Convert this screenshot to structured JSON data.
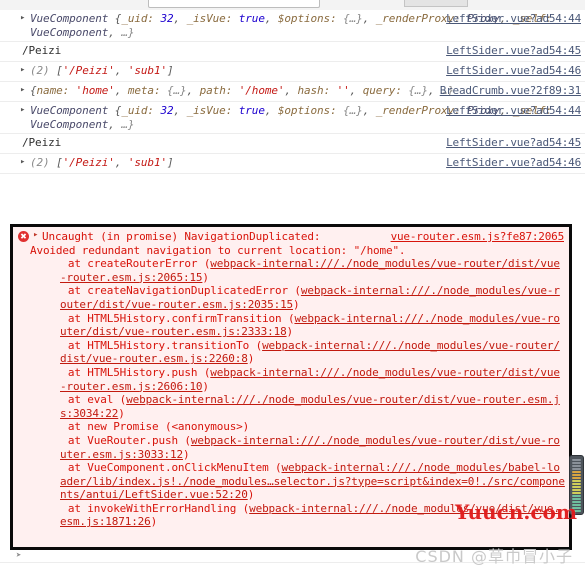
{
  "app": {
    "name": "chrome-devtools-console",
    "colors": {
      "error_text": "#d8140b",
      "error_bg": "#fff0f0",
      "source_link": "#4a5878",
      "string_token": "#c41a16",
      "number_token": "#1c00cf",
      "annotation_border": "#0a0a0a"
    }
  },
  "toolbar": {
    "filter_placeholder": ""
  },
  "console": {
    "messages": [
      {
        "type": "object",
        "disclosure": "▸",
        "text": "VueComponent {_uid: 32, _isVue: true, $options: {…}, _renderProxy: Proxy, _self: VueComponent, …}",
        "source": "LeftSider.vue?ad54:44",
        "parts": [
          {
            "t": "VueComponent ",
            "c": "tok-cls"
          },
          {
            "t": "{",
            "c": "tok-punc"
          },
          {
            "t": "_uid: ",
            "c": "tok-key"
          },
          {
            "t": "32",
            "c": "tok-num"
          },
          {
            "t": ", ",
            "c": "tok-punc"
          },
          {
            "t": "_isVue: ",
            "c": "tok-key"
          },
          {
            "t": "true",
            "c": "tok-bool"
          },
          {
            "t": ", ",
            "c": "tok-punc"
          },
          {
            "t": "$options: ",
            "c": "tok-key"
          },
          {
            "t": "{…}",
            "c": "tok-dim"
          },
          {
            "t": ", ",
            "c": "tok-punc"
          },
          {
            "t": "_renderProxy: ",
            "c": "tok-key"
          },
          {
            "t": "Proxy",
            "c": "tok-cls"
          },
          {
            "t": ", ",
            "c": "tok-punc"
          },
          {
            "t": "_self: ",
            "c": "tok-key"
          },
          {
            "t": "VueComponent",
            "c": "tok-cls"
          },
          {
            "t": ", ",
            "c": "tok-punc"
          },
          {
            "t": "…}",
            "c": "tok-dim"
          }
        ]
      },
      {
        "type": "string",
        "disclosure": "",
        "text": "/Peizi",
        "source": "LeftSider.vue?ad54:45",
        "parts": [
          {
            "t": "/Peizi",
            "c": "tok-name"
          }
        ]
      },
      {
        "type": "array",
        "disclosure": "▸",
        "text": "(2) ['/Peizi', 'sub1']",
        "source": "LeftSider.vue?ad54:46",
        "parts": [
          {
            "t": "(2) ",
            "c": "arr-count"
          },
          {
            "t": "[",
            "c": "tok-punc"
          },
          {
            "t": "'/Peizi'",
            "c": "tok-str"
          },
          {
            "t": ", ",
            "c": "tok-punc"
          },
          {
            "t": "'sub1'",
            "c": "tok-str"
          },
          {
            "t": "]",
            "c": "tok-punc"
          }
        ]
      },
      {
        "type": "object",
        "disclosure": "▸",
        "text": "{name: 'home', meta: {…}, path: '/home', hash: '', query: {…}, …}",
        "source": "BreadCrumb.vue?2f89:31",
        "parts": [
          {
            "t": "{",
            "c": "tok-punc"
          },
          {
            "t": "name: ",
            "c": "tok-key"
          },
          {
            "t": "'home'",
            "c": "tok-str"
          },
          {
            "t": ", ",
            "c": "tok-punc"
          },
          {
            "t": "meta: ",
            "c": "tok-key"
          },
          {
            "t": "{…}",
            "c": "tok-dim"
          },
          {
            "t": ", ",
            "c": "tok-punc"
          },
          {
            "t": "path: ",
            "c": "tok-key"
          },
          {
            "t": "'/home'",
            "c": "tok-str"
          },
          {
            "t": ", ",
            "c": "tok-punc"
          },
          {
            "t": "hash: ",
            "c": "tok-key"
          },
          {
            "t": "''",
            "c": "tok-str"
          },
          {
            "t": ", ",
            "c": "tok-punc"
          },
          {
            "t": "query: ",
            "c": "tok-key"
          },
          {
            "t": "{…}",
            "c": "tok-dim"
          },
          {
            "t": ", ",
            "c": "tok-punc"
          },
          {
            "t": "…}",
            "c": "tok-dim"
          }
        ]
      },
      {
        "type": "object",
        "disclosure": "▸",
        "text": "VueComponent {_uid: 32, _isVue: true, $options: {…}, _renderProxy: Proxy, _self: VueComponent, …}",
        "source": "LeftSider.vue?ad54:44",
        "parts": [
          {
            "t": "VueComponent ",
            "c": "tok-cls"
          },
          {
            "t": "{",
            "c": "tok-punc"
          },
          {
            "t": "_uid: ",
            "c": "tok-key"
          },
          {
            "t": "32",
            "c": "tok-num"
          },
          {
            "t": ", ",
            "c": "tok-punc"
          },
          {
            "t": "_isVue: ",
            "c": "tok-key"
          },
          {
            "t": "true",
            "c": "tok-bool"
          },
          {
            "t": ", ",
            "c": "tok-punc"
          },
          {
            "t": "$options: ",
            "c": "tok-key"
          },
          {
            "t": "{…}",
            "c": "tok-dim"
          },
          {
            "t": ", ",
            "c": "tok-punc"
          },
          {
            "t": "_renderProxy: ",
            "c": "tok-key"
          },
          {
            "t": "Proxy",
            "c": "tok-cls"
          },
          {
            "t": ", ",
            "c": "tok-punc"
          },
          {
            "t": "_self: ",
            "c": "tok-key"
          },
          {
            "t": "VueComponent",
            "c": "tok-cls"
          },
          {
            "t": ", ",
            "c": "tok-punc"
          },
          {
            "t": "…}",
            "c": "tok-dim"
          }
        ]
      },
      {
        "type": "string",
        "disclosure": "",
        "text": "/Peizi",
        "source": "LeftSider.vue?ad54:45",
        "parts": [
          {
            "t": "/Peizi",
            "c": "tok-name"
          }
        ]
      },
      {
        "type": "array",
        "disclosure": "▸",
        "text": "(2) ['/Peizi', 'sub1']",
        "source": "LeftSider.vue?ad54:46",
        "parts": [
          {
            "t": "(2) ",
            "c": "arr-count"
          },
          {
            "t": "[",
            "c": "tok-punc"
          },
          {
            "t": "'/Peizi'",
            "c": "tok-str"
          },
          {
            "t": ", ",
            "c": "tok-punc"
          },
          {
            "t": "'sub1'",
            "c": "tok-str"
          },
          {
            "t": "]",
            "c": "tok-punc"
          }
        ]
      }
    ]
  },
  "error": {
    "icon": "error-circle-icon",
    "disclosure": "▸",
    "headline": "Uncaught (in promise) NavigationDuplicated:",
    "detail": "Avoided redundant navigation to current location: \"/home\".",
    "source": "vue-router.esm.js?fe87:2065",
    "stack": [
      {
        "prefix": "    at createRouterError (",
        "link": "webpack-internal:///./node_modules/vue-router/dist/vue-router.esm.js:2065:15",
        "suffix": ")"
      },
      {
        "prefix": "    at createNavigationDuplicatedError (",
        "link": "webpack-internal:///./node_modules/vue-router/dist/vue-router.esm.js:2035:15",
        "suffix": ")"
      },
      {
        "prefix": "    at HTML5History.confirmTransition (",
        "link": "webpack-internal:///./node_modules/vue-router/dist/vue-router.esm.js:2333:18",
        "suffix": ")"
      },
      {
        "prefix": "    at HTML5History.transitionTo (",
        "link": "webpack-internal:///./node_modules/vue-router/dist/vue-router.esm.js:2260:8",
        "suffix": ")"
      },
      {
        "prefix": "    at HTML5History.push (",
        "link": "webpack-internal:///./node_modules/vue-router/dist/vue-router.esm.js:2606:10",
        "suffix": ")"
      },
      {
        "prefix": "    at eval (",
        "link": "webpack-internal:///./node_modules/vue-router/dist/vue-router.esm.js:3034:22",
        "suffix": ")"
      },
      {
        "prefix": "    at new Promise (<anonymous>)",
        "link": "",
        "suffix": ""
      },
      {
        "prefix": "    at VueRouter.push (",
        "link": "webpack-internal:///./node_modules/vue-router/dist/vue-router.esm.js:3033:12",
        "suffix": ")"
      },
      {
        "prefix": "    at VueComponent.onClickMenuItem (",
        "link": "webpack-internal:///./node_modules/babel-loader/lib/index.js!./node_modules…selector.js?type=script&index=0!./src/components/antui/LeftSider.vue:52:20",
        "suffix": ")"
      },
      {
        "prefix": "    at invokeWithErrorHandling (",
        "link": "webpack-internal:///./node_modules/vue/dist/vue.esm.js:1871:26",
        "suffix": ")"
      }
    ]
  },
  "minimap": {
    "rows": [
      "#8a9199",
      "#8a9199",
      "#8a9199",
      "#8a9199",
      "#d9a441",
      "#d9a441",
      "#d9a441",
      "#cfcf5a",
      "#cfcf5a",
      "#cfcf5a",
      "#cfcf5a",
      "#cfcf5a",
      "#6fbf9f",
      "#6fbf9f",
      "#6fbf9f",
      "#6fbf9f",
      "#6fbf9f",
      "#6fbf9f"
    ]
  },
  "watermarks": {
    "yuucn": "Yuucn.com",
    "csdn": "CSDN @草巾冒小子"
  }
}
